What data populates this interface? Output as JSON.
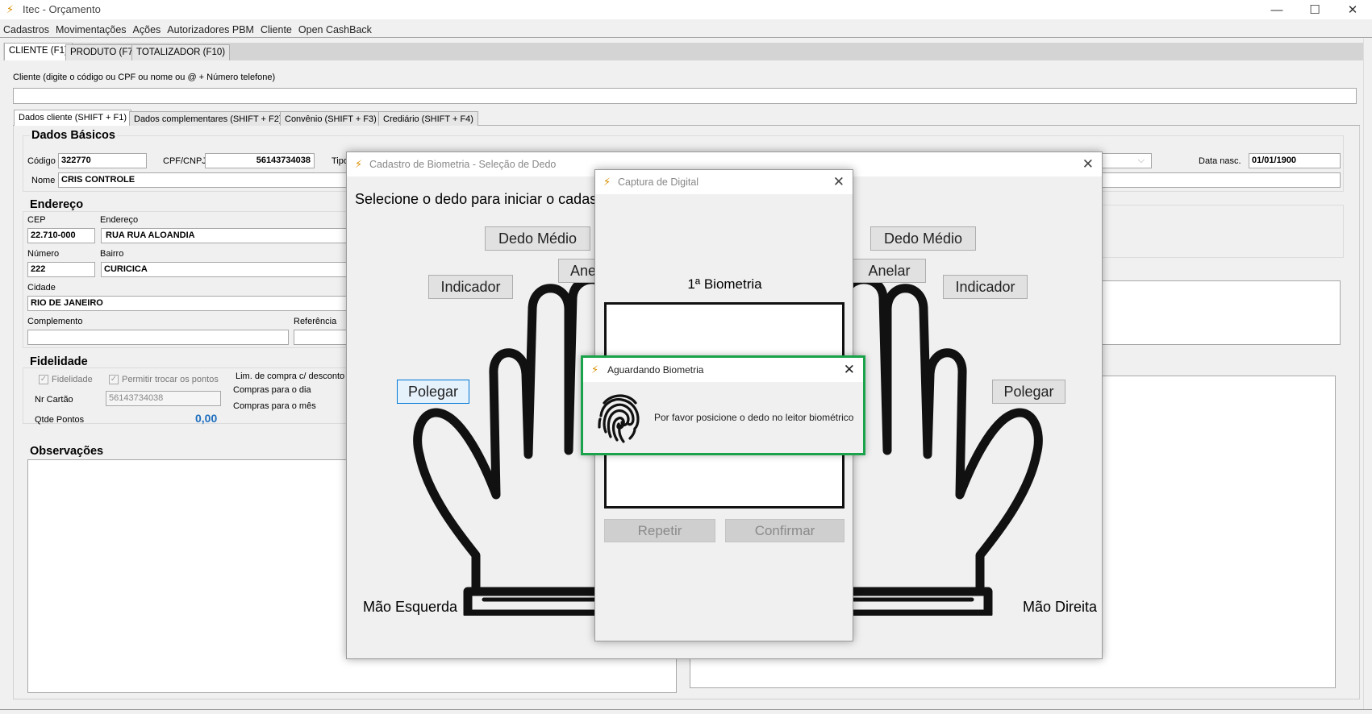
{
  "window": {
    "title": "Itec - Orçamento"
  },
  "menu": [
    "Cadastros",
    "Movimentações",
    "Ações",
    "Autorizadores PBM",
    "Cliente",
    "Open CashBack"
  ],
  "main_tabs": [
    "CLIENTE (F1)",
    "PRODUTO (F7)",
    "TOTALIZADOR (F10)"
  ],
  "client_search": {
    "label": "Cliente (digite o código ou CPF ou nome ou @ + Número telefone)",
    "value": ""
  },
  "sub_tabs": [
    "Dados cliente (SHIFT + F1)",
    "Dados complementares (SHIFT + F2)",
    "Convênio (SHIFT + F3)",
    "Crediário (SHIFT + F4)"
  ],
  "dados_basicos": {
    "title": "Dados Básicos",
    "codigo_label": "Código",
    "codigo": "322770",
    "cpf_label": "CPF/CNPJ",
    "cpf": "56143734038",
    "tipo_label": "Tipo",
    "nome_label": "Nome",
    "nome": "CRIS CONTROLE",
    "data_nasc_label": "Data nasc.",
    "data_nasc": "01/01/1900"
  },
  "endereco": {
    "title": "Endereço",
    "cep_label": "CEP",
    "cep": "22.710-000",
    "endereco_label": "Endereço",
    "endereco": "RUA RUA ALOANDIA",
    "numero_label": "Número",
    "numero": "222",
    "bairro_label": "Bairro",
    "bairro": "CURICICA",
    "cidade_label": "Cidade",
    "cidade": "RIO DE JANEIRO",
    "complemento_label": "Complemento",
    "complemento": "",
    "referencia_label": "Referência"
  },
  "fidelidade": {
    "title": "Fidelidade",
    "fidelidade_check": "Fidelidade",
    "trocar_check": "Permitir trocar os pontos",
    "nr_cartao_label": "Nr Cartão",
    "nr_cartao": "56143734038",
    "qtde_label": "Qtde Pontos",
    "qtde": "0,00",
    "lim_label": "Lim. de compra c/ desconto",
    "dia_label": "Compras para o dia",
    "mes_label": "Compras para o mês"
  },
  "observacoes": {
    "title": "Observações"
  },
  "biometria_dialog": {
    "title": "Cadastro de Biometria - Seleção de Dedo",
    "instruction": "Selecione o dedo para iniciar o cadast",
    "left": {
      "medio": "Dedo Médio",
      "anelar": "Ane",
      "indicador": "Indicador",
      "polegar": "Polegar",
      "label": "Mão Esquerda"
    },
    "right": {
      "medio": "Dedo Médio",
      "anelar": "Anelar",
      "indicador": "Indicador",
      "polegar": "Polegar",
      "label": "Mão Direita"
    }
  },
  "captura_dialog": {
    "title": "Captura de Digital",
    "heading": "1ª Biometria",
    "repetir": "Repetir",
    "confirmar": "Confirmar"
  },
  "aguardando_dialog": {
    "title": "Aguardando Biometria",
    "message": "Por favor posicione o dedo no leitor biométrico"
  },
  "colors": {
    "accent_green": "#1aa34a",
    "points_blue": "#1f6fbf",
    "logo_orange": "#d98e00"
  }
}
